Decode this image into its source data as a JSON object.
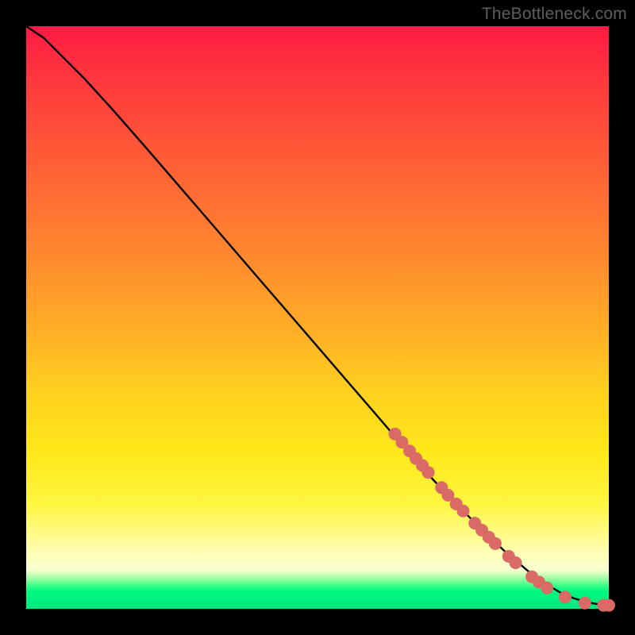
{
  "watermark": "TheBottleneck.com",
  "chart_data": {
    "type": "line",
    "title": "",
    "xlabel": "",
    "ylabel": "",
    "xlim": [
      0,
      100
    ],
    "ylim": [
      0,
      100
    ],
    "grid": false,
    "legend": false,
    "series": [
      {
        "name": "curve",
        "x": [
          0,
          3,
          6,
          10,
          15,
          20,
          25,
          30,
          35,
          40,
          45,
          50,
          55,
          60,
          63,
          66,
          70,
          74,
          78,
          82,
          86,
          90,
          92,
          94,
          96,
          98,
          100
        ],
        "y": [
          100,
          98,
          95,
          91,
          85.5,
          79.8,
          74.0,
          68.2,
          62.4,
          56.6,
          50.8,
          45.0,
          39.2,
          33.4,
          29.9,
          26.5,
          22.0,
          17.8,
          13.8,
          10.0,
          6.6,
          3.8,
          2.6,
          1.8,
          1.2,
          0.8,
          0.6
        ]
      }
    ],
    "markers": [
      {
        "x": 63.3,
        "y": 30.0
      },
      {
        "x": 64.5,
        "y": 28.6
      },
      {
        "x": 65.8,
        "y": 27.1
      },
      {
        "x": 66.9,
        "y": 25.8
      },
      {
        "x": 68.0,
        "y": 24.6
      },
      {
        "x": 69.0,
        "y": 23.4
      },
      {
        "x": 71.3,
        "y": 20.8
      },
      {
        "x": 72.4,
        "y": 19.5
      },
      {
        "x": 73.8,
        "y": 18.0
      },
      {
        "x": 75.0,
        "y": 16.8
      },
      {
        "x": 77.0,
        "y": 14.7
      },
      {
        "x": 78.2,
        "y": 13.5
      },
      {
        "x": 79.4,
        "y": 12.3
      },
      {
        "x": 80.5,
        "y": 11.2
      },
      {
        "x": 82.8,
        "y": 9.0
      },
      {
        "x": 84.0,
        "y": 7.9
      },
      {
        "x": 86.8,
        "y": 5.5
      },
      {
        "x": 88.0,
        "y": 4.6
      },
      {
        "x": 89.4,
        "y": 3.6
      },
      {
        "x": 92.5,
        "y": 2.0
      },
      {
        "x": 95.9,
        "y": 1.0
      },
      {
        "x": 99.1,
        "y": 0.6
      },
      {
        "x": 100.0,
        "y": 0.6
      }
    ],
    "marker_style": {
      "color": "#d96a66",
      "radius_px": 8
    }
  }
}
